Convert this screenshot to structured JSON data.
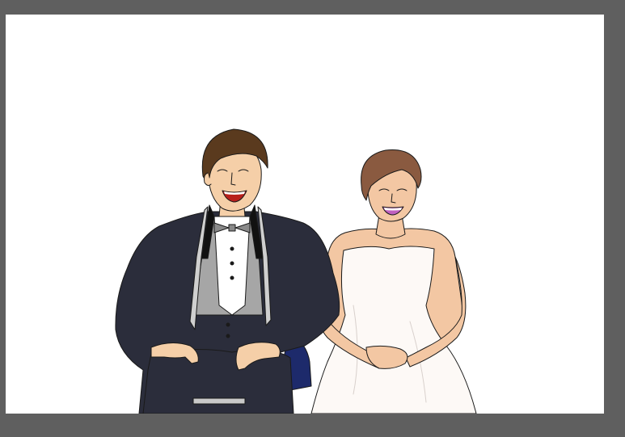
{
  "canvas": {
    "workspace_color": "#5f5f5f",
    "artboard_color": "#ffffff"
  },
  "illustration": {
    "subject": "wedding-couple-illustration",
    "colors": {
      "tuxedo": "#2b2d3b",
      "lapel_trim": "#cfcfcf",
      "vest": "#a6a6a6",
      "shirt": "#ffffff",
      "groom_skin": "#f5cfa8",
      "groom_hair": "#5a3a1e",
      "bride_skin": "#f3c7a3",
      "bride_hair": "#8a5a40",
      "dress": "#fdf9f6",
      "chair_back": "#1d2a6b",
      "chair_seat": "#c9c9c9",
      "chair_leg": "#6b5a52",
      "outline": "#1a1a1a",
      "groom_mouth": "#b8201c",
      "bride_mouth": "#c060c0"
    }
  }
}
